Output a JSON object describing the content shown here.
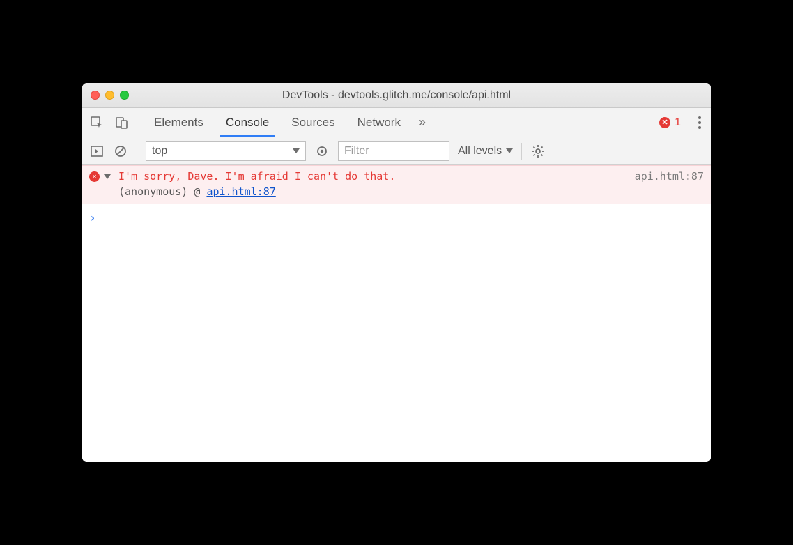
{
  "window": {
    "title": "DevTools - devtools.glitch.me/console/api.html"
  },
  "tabs": {
    "items": [
      "Elements",
      "Console",
      "Sources",
      "Network"
    ],
    "active_index": 1,
    "overflow_glyph": "»"
  },
  "error_indicator": {
    "glyph": "✕",
    "count": "1"
  },
  "toolbar": {
    "context": "top",
    "filter_placeholder": "Filter",
    "levels_label": "All levels"
  },
  "console": {
    "error": {
      "message": "I'm sorry, Dave. I'm afraid I can't do that.",
      "source": "api.html:87",
      "stack_prefix": "(anonymous) @ ",
      "stack_link": "api.html:87"
    },
    "prompt_glyph": "›"
  }
}
